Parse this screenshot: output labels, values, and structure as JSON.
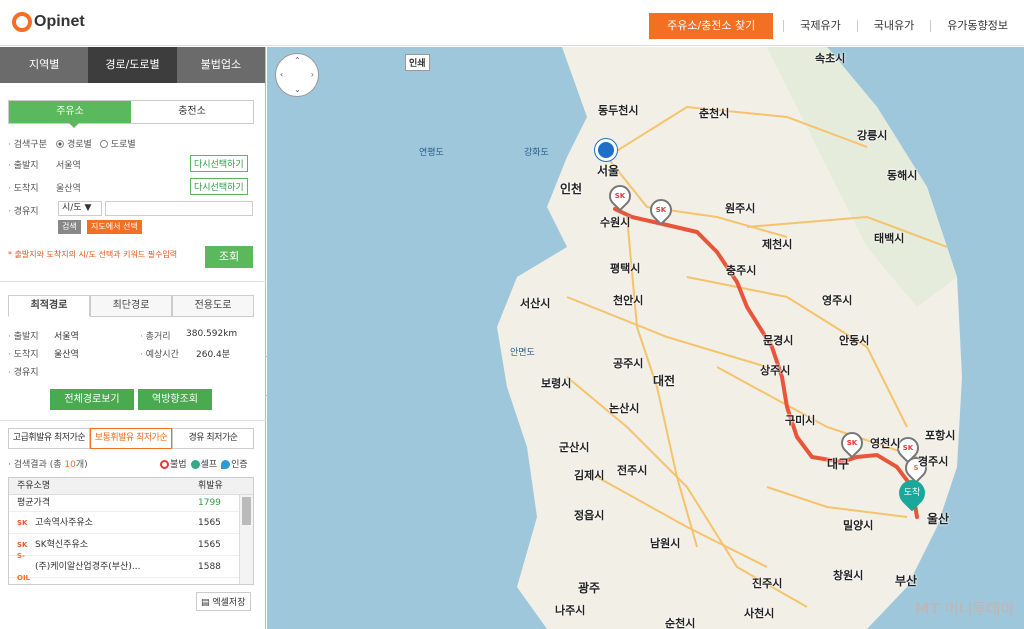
{
  "header": {
    "logo": "Opinet",
    "nav": [
      "주유소/충전소 찾기",
      "국제유가",
      "국내유가",
      "유가동향정보"
    ]
  },
  "sidebar": {
    "tabs": [
      "지역별",
      "경로/도로별",
      "불법업소"
    ],
    "type_tabs": [
      "주유소",
      "충전소"
    ],
    "search_type_label": "검색구분",
    "search_type_options": [
      "경로별",
      "도로별"
    ],
    "origin_label": "출발지",
    "origin_value": "서울역",
    "dest_label": "도착지",
    "dest_value": "울산역",
    "reselect_label": "다시선택하기",
    "via_label": "경유지",
    "via_select": "시/도 ▼",
    "search_small": "검색",
    "map_select": "지도에서 선택",
    "notice": "* 출발지와 도착지의 시/도 선택과 키워드 필수입력",
    "search_button": "조회",
    "route_tabs": [
      "최적경로",
      "최단경로",
      "전용도로"
    ],
    "route_info": {
      "origin_label": "출발지",
      "origin": "서울역",
      "dest_label": "도착지",
      "dest": "울산역",
      "via_label": "경유지",
      "distance_label": "총거리",
      "distance": "380.592km",
      "time_label": "예상시간",
      "time": "260.4분"
    },
    "full_route_btn": "전체경로보기",
    "reverse_btn": "역방향조회",
    "rank_tabs": [
      "고급휘발유 최저가순",
      "보통휘발유 최저가순",
      "경유 최저가순"
    ],
    "result_prefix": "검색결과 (총 ",
    "result_count": "10",
    "result_suffix": "개)",
    "legend": [
      "불법",
      "셀프",
      "인증"
    ],
    "table": {
      "headers": [
        "주유소명",
        "휘발유"
      ],
      "avg_label": "평균가격",
      "avg_value": "1799",
      "rows": [
        {
          "name": "고속역사주유소",
          "price": "1565",
          "brand": "SK"
        },
        {
          "name": "SK혁신주유소",
          "price": "1565",
          "brand": "SK"
        },
        {
          "name": "(주)케이알산업경주(부산)...",
          "price": "1588",
          "brand": "S-OIL"
        }
      ]
    },
    "excel_btn": "엑셀저장"
  },
  "map": {
    "badge": "인쇄",
    "arrival": "도착",
    "watermark": "MT 머니투데이",
    "cities": [
      {
        "name": "속초시"
      },
      {
        "name": "동두천시"
      },
      {
        "name": "춘천시"
      },
      {
        "name": "강릉시"
      },
      {
        "name": "강화도"
      },
      {
        "name": "서울"
      },
      {
        "name": "인천"
      },
      {
        "name": "동해시"
      },
      {
        "name": "원주시"
      },
      {
        "name": "수원시"
      },
      {
        "name": "태백시"
      },
      {
        "name": "제천시"
      },
      {
        "name": "평택시"
      },
      {
        "name": "충주시"
      },
      {
        "name": "영주시"
      },
      {
        "name": "서산시"
      },
      {
        "name": "천안시"
      },
      {
        "name": "안동시"
      },
      {
        "name": "문경시"
      },
      {
        "name": "공주시"
      },
      {
        "name": "상주시"
      },
      {
        "name": "보령시"
      },
      {
        "name": "대전"
      },
      {
        "name": "논산시"
      },
      {
        "name": "구미시"
      },
      {
        "name": "포항시"
      },
      {
        "name": "군산시"
      },
      {
        "name": "영천시"
      },
      {
        "name": "김제시"
      },
      {
        "name": "전주시"
      },
      {
        "name": "대구"
      },
      {
        "name": "경주시"
      },
      {
        "name": "정읍시"
      },
      {
        "name": "울산"
      },
      {
        "name": "밀양시"
      },
      {
        "name": "남원시"
      },
      {
        "name": "창원시"
      },
      {
        "name": "광주"
      },
      {
        "name": "진주시"
      },
      {
        "name": "부산"
      },
      {
        "name": "나주시"
      },
      {
        "name": "사천시"
      },
      {
        "name": "순천시"
      }
    ],
    "seas": [
      {
        "name": "연평도"
      },
      {
        "name": "안면도"
      }
    ]
  },
  "colors": {
    "accent": "#f36f21",
    "green": "#5cb85c",
    "route": "#e8553b"
  }
}
